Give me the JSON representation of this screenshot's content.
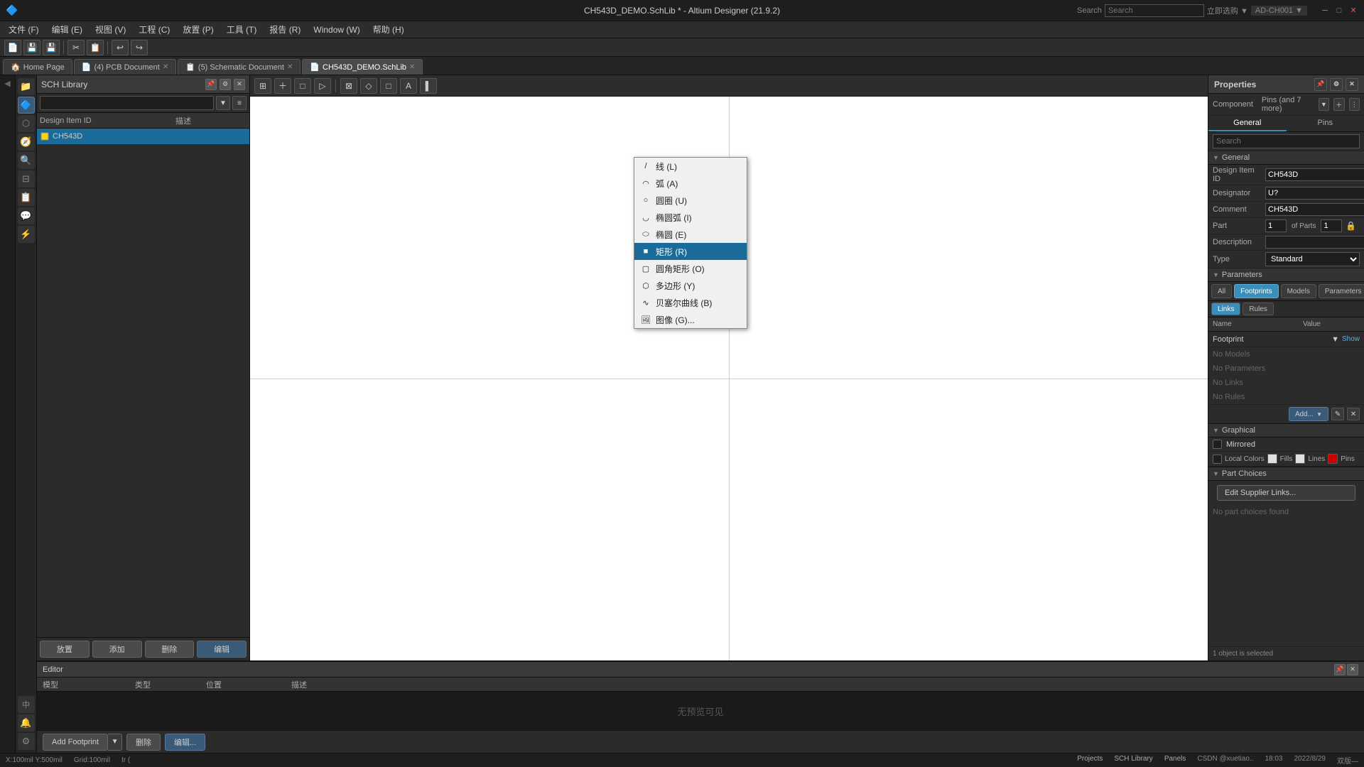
{
  "titleBar": {
    "title": "CH543D_DEMO.SchLib * - Altium Designer (21.9.2)",
    "searchPlaceholder": "Search",
    "searchLabel": "Search",
    "minBtn": "─",
    "maxBtn": "□",
    "closeBtn": "✕"
  },
  "menuBar": {
    "items": [
      {
        "label": "文件 (F)"
      },
      {
        "label": "编辑 (E)"
      },
      {
        "label": "视图 (V)"
      },
      {
        "label": "工程 (C)"
      },
      {
        "label": "放置 (P)"
      },
      {
        "label": "工具 (T)"
      },
      {
        "label": "报告 (R)"
      },
      {
        "label": "Window (W)"
      },
      {
        "label": "帮助 (H)"
      }
    ]
  },
  "topIcons": {
    "icons": [
      "📁",
      "💾",
      "✂",
      "📋",
      "↩",
      "↪",
      "🔍"
    ]
  },
  "tabs": [
    {
      "label": "Home Page",
      "icon": "🏠",
      "active": false
    },
    {
      "label": "(4) PCB Document",
      "icon": "📄",
      "active": false
    },
    {
      "label": "(5) Schematic Document",
      "icon": "📋",
      "active": false
    },
    {
      "label": "CH543D_DEMO.SchLib",
      "icon": "📄",
      "active": true
    }
  ],
  "schLibPanel": {
    "title": "SCH Library",
    "searchPlaceholder": "",
    "columns": {
      "designItemId": "Design Item ID",
      "description": "描述"
    },
    "components": [
      {
        "id": "CH543D",
        "description": "",
        "selected": true
      }
    ],
    "actionButtons": {
      "place": "放置",
      "add": "添加",
      "delete": "删除",
      "edit": "编辑"
    }
  },
  "toolbar": {
    "buttons": [
      "⊞",
      "＋",
      "□",
      "▷",
      "⊠",
      "◇",
      "□",
      "A",
      "▌"
    ]
  },
  "contextMenu": {
    "items": [
      {
        "label": "线 (L)",
        "icon": "/",
        "shortcut": "L"
      },
      {
        "label": "弧 (A)",
        "icon": "◠",
        "shortcut": "A"
      },
      {
        "label": "圆圈 (U)",
        "icon": "○",
        "shortcut": "U"
      },
      {
        "label": "椭圆弧 (I)",
        "icon": "◡",
        "shortcut": "I"
      },
      {
        "label": "椭圆 (E)",
        "icon": "⬭",
        "shortcut": "E"
      },
      {
        "label": "矩形 (R)",
        "icon": "■",
        "shortcut": "R",
        "selected": true
      },
      {
        "label": "圆角矩形 (O)",
        "icon": "▢",
        "shortcut": "O"
      },
      {
        "label": "多边形 (Y)",
        "icon": "⬡",
        "shortcut": "Y"
      },
      {
        "label": "贝塞尔曲线 (B)",
        "icon": "∿",
        "shortcut": "B"
      },
      {
        "label": "图像 (G)...",
        "icon": "🖼",
        "shortcut": "G"
      }
    ]
  },
  "propertiesPanel": {
    "title": "Properties",
    "tabs": [
      "General",
      "Pins"
    ],
    "activeTab": "General",
    "componentLabel": "Component",
    "pinsLabel": "Pins (and 7 more)",
    "searchPlaceholder": "Search",
    "fields": {
      "designItemId": {
        "label": "Design Item ID",
        "value": "CH543D"
      },
      "designator": {
        "label": "Designator",
        "value": "U?"
      },
      "comment": {
        "label": "Comment",
        "value": "CH543D"
      },
      "part": {
        "label": "Part",
        "value": "1",
        "ofParts": "of Parts",
        "partsCount": "1"
      },
      "description": {
        "label": "Description",
        "value": ""
      },
      "type": {
        "label": "Type",
        "value": "Standard"
      }
    },
    "parameters": {
      "sectionLabel": "Parameters",
      "tabs": [
        "All",
        "Footprints",
        "Models",
        "Parameters"
      ],
      "activeTab": "Footprints",
      "subTabs": [
        "Links",
        "Rules"
      ],
      "activeSubTab": "Links",
      "columns": {
        "name": "Name",
        "value": "Value"
      },
      "rows": [
        {
          "name": "Footprint",
          "value": "",
          "showBtn": "Show"
        }
      ],
      "noModels": "No Models",
      "noParameters": "No Parameters",
      "noLinks": "No Links",
      "noRules": "No Rules",
      "addBtn": "Add...",
      "addDropdown": "▼"
    },
    "graphical": {
      "sectionLabel": "Graphical",
      "mirroredLabel": "Mirrored",
      "mirrored": false,
      "localColors": {
        "label": "Local Colors",
        "fills": "Fills",
        "lines": "Lines",
        "pins": "Pins",
        "fillsColor": "#e0e0e0",
        "linesColor": "#cc0000",
        "pinsColor": "#cc0000"
      }
    },
    "partChoices": {
      "sectionLabel": "Part Choices",
      "editBtn": "Edit Supplier Links...",
      "noChoices": "No part choices found"
    },
    "selectedMsg": "1 object is selected"
  },
  "editorPanel": {
    "title": "Editor",
    "columns": {
      "model": "模型",
      "type": "类型",
      "position": "位置",
      "description": "描述"
    },
    "footerButtons": {
      "addFootprint": "Add Footprint",
      "delete": "删除",
      "edit": "编辑..."
    },
    "noItems": "无预览可见"
  },
  "statusBar": {
    "left": [
      {
        "label": "X:100mil Y:500mil"
      },
      {
        "label": "Grid:100mil"
      }
    ],
    "center": "Ir (",
    "right": [
      {
        "label": "Projects"
      },
      {
        "label": "SCH Library"
      }
    ],
    "panelLabel": "Panels",
    "csdn": "CSDN @xuetiao..",
    "time": "18:03",
    "date": "2022/8/29",
    "mode": "双版—"
  },
  "leftIcons": {
    "icons": [
      {
        "symbol": "⊞",
        "name": "home-icon"
      },
      {
        "symbol": "⊡",
        "name": "grid-icon"
      },
      {
        "symbol": "✎",
        "name": "edit-icon"
      },
      {
        "symbol": "📋",
        "name": "clipboard-icon"
      },
      {
        "symbol": "⚡",
        "name": "power-icon"
      },
      {
        "symbol": "🔗",
        "name": "link-icon"
      },
      {
        "symbol": "◎",
        "name": "circle-icon"
      },
      {
        "symbol": "⬡",
        "name": "hex-icon"
      },
      {
        "symbol": "🛠",
        "name": "tools-icon"
      },
      {
        "symbol": "🔌",
        "name": "plugin-icon"
      },
      {
        "symbol": "🖊",
        "name": "pen-icon"
      },
      {
        "symbol": "中",
        "name": "chinese-icon"
      },
      {
        "symbol": "⚙",
        "name": "gear-icon"
      }
    ]
  }
}
